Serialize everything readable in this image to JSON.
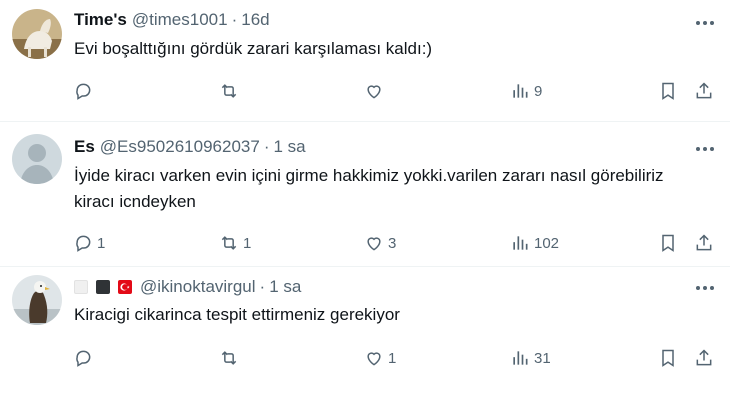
{
  "tweets": [
    {
      "name": "Time's",
      "handle": "@times1001",
      "time": "16d",
      "text": "Evi boşalttığını gördük zarari karşılaması kaldı:)",
      "replies": "",
      "retweets": "",
      "likes": "",
      "views": "9"
    },
    {
      "name": "Es",
      "handle": "@Es9502610962037",
      "time": "1 sa",
      "text": "İyide kiracı varken evin içini girme hakkimiz yokki.varilen zararı nasıl görebiliriz kiracı icndeyken",
      "replies": "1",
      "retweets": "1",
      "likes": "3",
      "views": "102"
    },
    {
      "name": "",
      "handle": "@ikinoktavirgul",
      "time": "1 sa",
      "text": "Kiracigi cikarinca tespit ettirmeniz gerekiyor",
      "replies": "",
      "retweets": "",
      "likes": "1",
      "views": "31"
    }
  ],
  "separator": "·",
  "colors": {
    "text": "#0f1419",
    "secondary": "#536471",
    "divider": "#eff3f4",
    "flag_red": "#e30a17"
  },
  "icons": [
    "reply-icon",
    "retweet-icon",
    "like-icon",
    "views-icon",
    "bookmark-icon",
    "share-icon",
    "more-icon"
  ]
}
